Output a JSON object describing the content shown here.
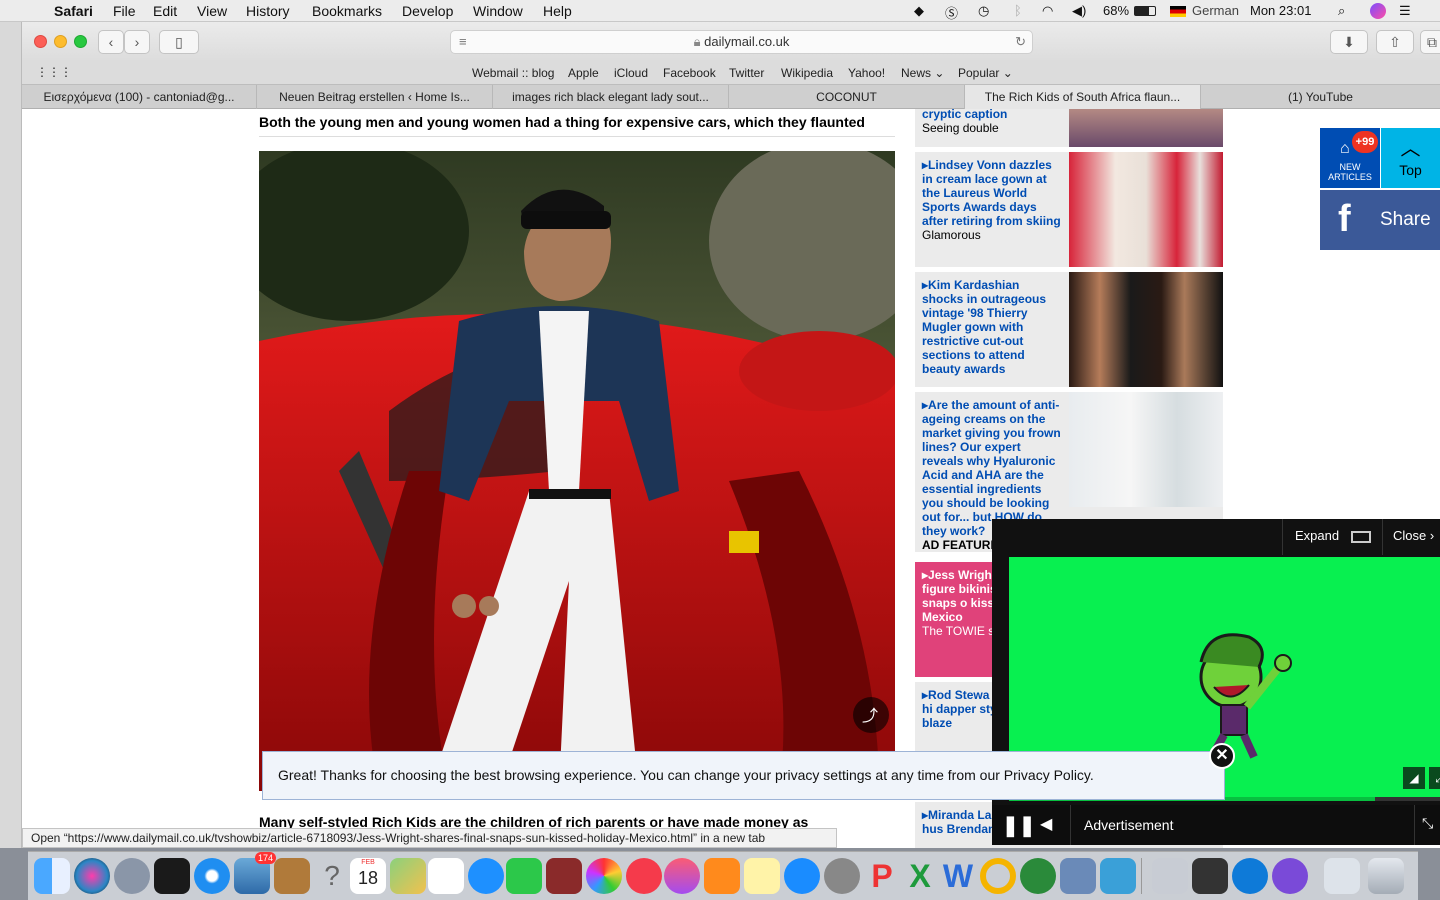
{
  "menubar": {
    "app": "Safari",
    "items": [
      "File",
      "Edit",
      "View",
      "History",
      "Bookmarks",
      "Develop",
      "Window",
      "Help"
    ],
    "battery": "68%",
    "input_source": "German",
    "clock": "Mon 23:01"
  },
  "browser": {
    "url": "dailymail.co.uk",
    "favorites": [
      "Webmail :: blog",
      "Apple",
      "iCloud",
      "Facebook",
      "Twitter",
      "Wikipedia",
      "Yahoo!",
      "News",
      "Popular"
    ],
    "tabs": [
      "Εισερχόμενα (100) - cantoniad@g...",
      "Neuen Beitrag erstellen ‹ Home Is...",
      "images rich black elegant lady sout...",
      "COCONUT",
      "The Rich Kids of South Africa flaun...",
      "(1) YouTube"
    ],
    "status": "Open “https://www.dailymail.co.uk/tvshowbiz/article-6718093/Jess-Wright-shares-final-snaps-sun-kissed-holiday-Mexico.html” in a new tab"
  },
  "article": {
    "caption_top": "Both the young men and young women had a thing for expensive cars, which they flaunted",
    "caption_bottom": "Many self-styled Rich Kids are the children of rich parents or have made money as entrepreneurs"
  },
  "sidebar": [
    {
      "title": "cryptic caption",
      "tag": "Seeing double"
    },
    {
      "title": "Lindsey Vonn dazzles in cream lace gown at the Laureus World Sports Awards days after retiring from skiing",
      "tag": "Glamorous"
    },
    {
      "title": "Kim Kardashian shocks in outrageous vintage '98 Thierry Mugler gown with restrictive cut-out sections to attend beauty awards",
      "tag": ""
    },
    {
      "title": "Are the amount of anti-ageing creams on the market giving you frown lines? Our expert reveals why Hyaluronic Acid and AHA are the essential ingredients you should be looking out for... but HOW do they work?",
      "tag": "AD FEATURE"
    },
    {
      "title": "Jess Wright sultry figure bikinis as sh final snaps o kissed holid Mexico",
      "tag": "The TOWIE s"
    },
    {
      "title": "Rod Stewa shows off hi dapper style tuxedo blaze",
      "tag": ""
    },
    {
      "title": "Miranda La her new hus Brendan McL",
      "tag": ""
    }
  ],
  "floating": {
    "new_badge": "+99",
    "new_label_1": "NEW",
    "new_label_2": "ARTICLES",
    "top": "Top",
    "share": "Share"
  },
  "video_ad": {
    "expand": "Expand",
    "close": "Close",
    "label": "Advertisement"
  },
  "cookie": {
    "message": "Great! Thanks for choosing the best browsing experience. You can change your privacy settings at any time from our Privacy Policy."
  },
  "dock": {
    "calendar_month": "FEB",
    "calendar_day": "18",
    "mail_badge": "174"
  }
}
